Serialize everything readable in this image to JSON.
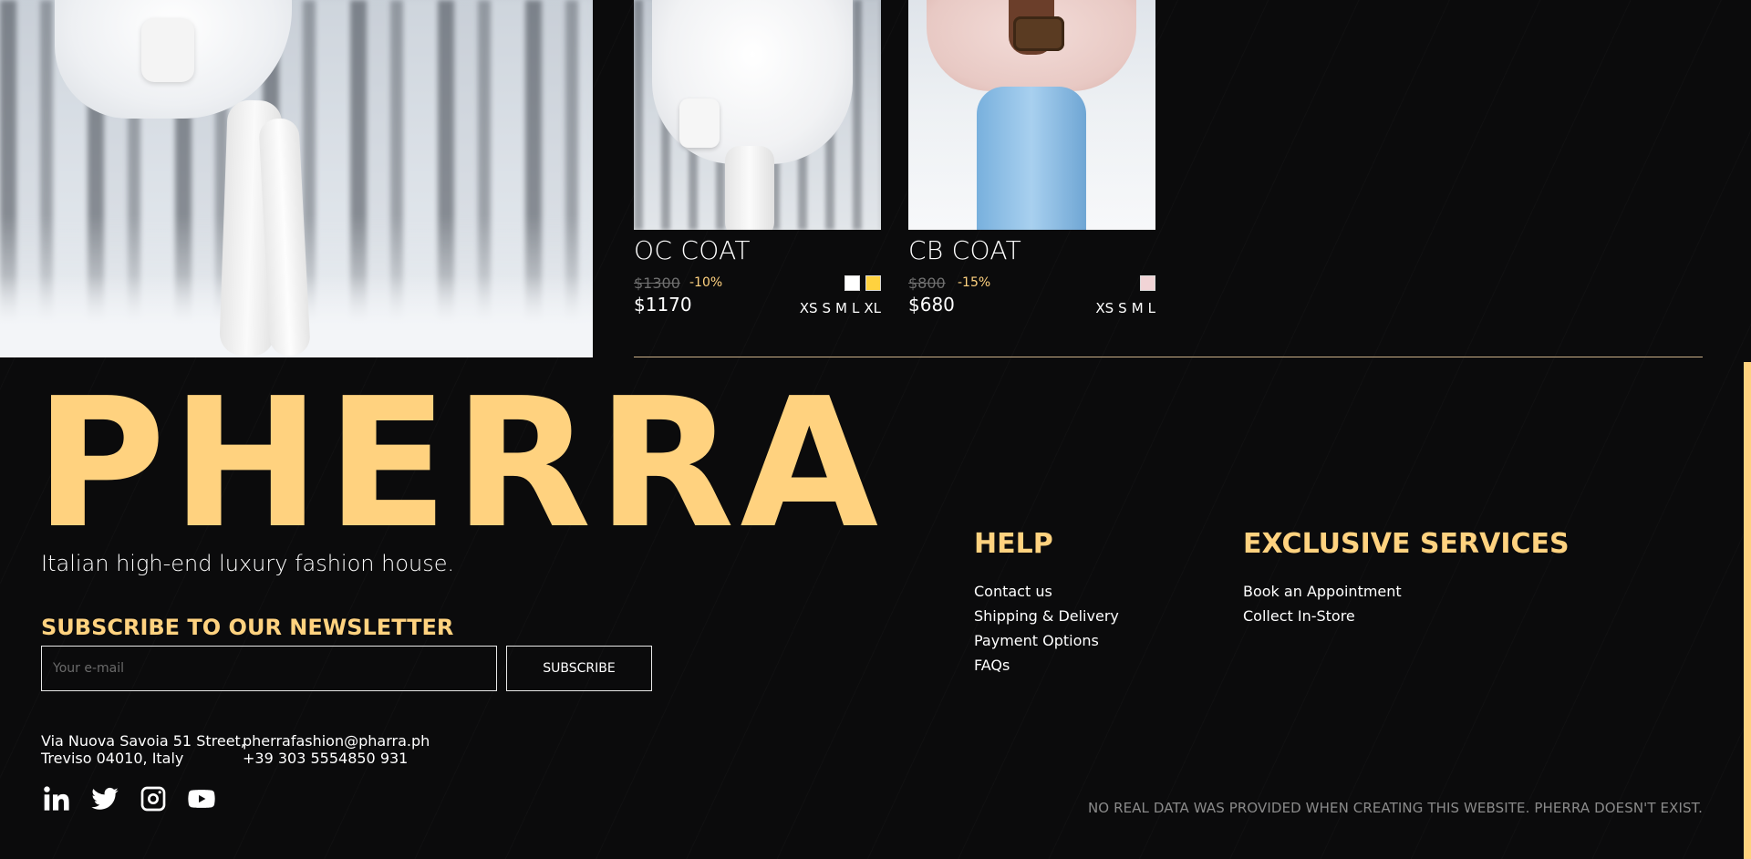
{
  "products": [
    {
      "name": "OC COAT",
      "old_price": "$1300",
      "discount": "-10%",
      "price": "$1170",
      "colors": [
        "#ffffff",
        "#ffd23f"
      ],
      "sizes": [
        "XS",
        "S",
        "M",
        "L",
        "XL"
      ]
    },
    {
      "name": "CB COAT",
      "old_price": "$800",
      "discount": "-15%",
      "price": "$680",
      "colors": [
        "#f1d4d6"
      ],
      "sizes": [
        "XS",
        "S",
        "M",
        "L"
      ]
    }
  ],
  "footer": {
    "brand": "PHERRA",
    "tagline": "Italian high-end luxury fashion house.",
    "newsletter": {
      "title": "SUBSCRIBE TO OUR NEWSLETTER",
      "placeholder": "Your e-mail",
      "button": "SUBSCRIBE"
    },
    "address": {
      "line1": "Via Nuova Savoia 51 Street,",
      "line2": "Treviso 04010, Italy"
    },
    "contact": {
      "email": "pherrafashion@pharra.ph",
      "phone": "+39 303 5554850 931"
    },
    "socials": [
      "linkedin-icon",
      "twitter-icon",
      "instagram-icon",
      "youtube-icon"
    ],
    "help": {
      "title": "HELP",
      "links": [
        "Contact us",
        "Shipping & Delivery",
        "Payment Options",
        "FAQs"
      ]
    },
    "exclusive": {
      "title": "EXCLUSIVE SERVICES",
      "links": [
        "Book an Appointment",
        "Collect In-Store"
      ]
    },
    "disclaimer": "NO REAL DATA WAS PROVIDED WHEN CREATING THIS WEBSITE. PHERRA DOESN'T EXIST."
  },
  "colors": {
    "background": "#0b0b0c",
    "accent": "#ffd27f",
    "divider": "#cbb089"
  }
}
